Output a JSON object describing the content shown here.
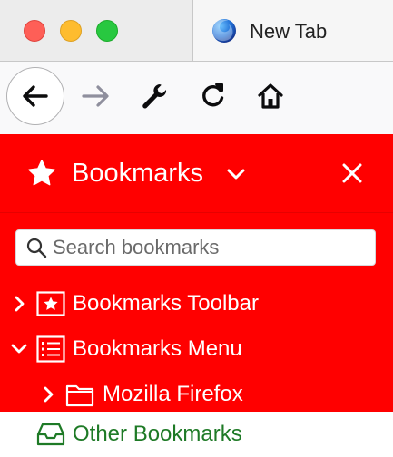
{
  "window": {
    "tab_title": "New Tab",
    "tab_favicon": "firefox-logo-icon"
  },
  "toolbar": {
    "buttons": [
      {
        "id": "back",
        "icon": "back-arrow-icon"
      },
      {
        "id": "forward",
        "icon": "forward-arrow-icon"
      },
      {
        "id": "tools",
        "icon": "wrench-icon"
      },
      {
        "id": "reload",
        "icon": "reload-icon"
      },
      {
        "id": "home",
        "icon": "home-icon"
      }
    ]
  },
  "sidebar": {
    "title": "Bookmarks",
    "background_color": "#ff0000",
    "search": {
      "placeholder": "Search bookmarks",
      "value": ""
    },
    "tree": [
      {
        "label": "Bookmarks Toolbar",
        "expanded": false,
        "icon": "bookmarks-toolbar-icon",
        "level": 0
      },
      {
        "label": "Bookmarks Menu",
        "expanded": true,
        "icon": "bookmarks-menu-icon",
        "level": 0
      },
      {
        "label": "Mozilla Firefox",
        "expanded": false,
        "icon": "folder-icon",
        "level": 1
      },
      {
        "label": "Other Bookmarks",
        "expanded": false,
        "icon": "other-bookmarks-icon",
        "level": 0,
        "selected": true
      }
    ]
  },
  "colors": {
    "selected_text": "#1e7a26",
    "sidebar_red": "#ff0000"
  }
}
